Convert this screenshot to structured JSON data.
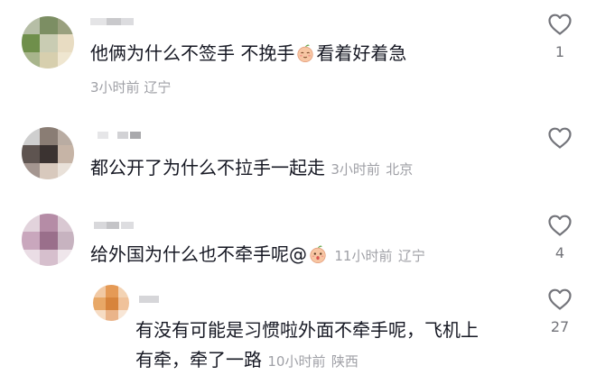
{
  "comments": [
    {
      "text_before": "他俩为什么不签手 不挽手",
      "text_after": "看着好着急",
      "emoji": "peach-face-emoji",
      "time": "3小时前",
      "location": "辽宁",
      "likes": "1"
    },
    {
      "text": "都公开了为什么不拉手一起走",
      "time": "3小时前",
      "location": "北京",
      "likes": ""
    },
    {
      "text_before": "给外国为什么也不牵手呢@",
      "emoji": "surprised-peach-emoji",
      "time": "11小时前",
      "location": "辽宁",
      "likes": "4"
    },
    {
      "line1": "有没有可能是习惯啦外面不牵手呢，飞机上",
      "line2": "有牵，牵了一路",
      "time": "10小时前",
      "location": "陕西",
      "likes": "27"
    }
  ],
  "colors": {
    "text": "#161823",
    "meta": "#9fa0a6",
    "icon": "#73747a",
    "background": "#ffffff"
  },
  "icons": {
    "like": "heart-outline-icon"
  }
}
